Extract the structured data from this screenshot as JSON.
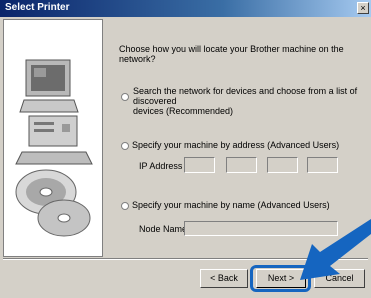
{
  "window": {
    "title": "Select Printer",
    "close_glyph": "×"
  },
  "content": {
    "prompt": "Choose how you will locate your Brother machine on the network?",
    "options": [
      {
        "label_line1": "Search the network for devices and choose from a list of discovered",
        "label_line2": "devices (Recommended)",
        "selected": false
      },
      {
        "label_line1": "Specify your machine by address (Advanced Users)",
        "selected": false
      },
      {
        "label_line1": "Specify your machine by name (Advanced Users)",
        "selected": false
      }
    ],
    "ip_address_label": "IP Address",
    "ip_octets": [
      "",
      "",
      "",
      ""
    ],
    "node_name_label": "Node Name",
    "node_name_value": ""
  },
  "buttons": {
    "back": "< Back",
    "next": "Next >",
    "cancel": "Cancel"
  },
  "colors": {
    "highlight": "#1565c0",
    "dialog_bg": "#d4d0c8"
  },
  "icons": [
    "computer-illustration",
    "cd-disc-illustration",
    "pointer-arrow"
  ]
}
